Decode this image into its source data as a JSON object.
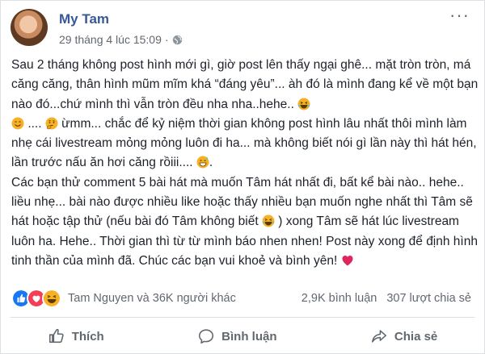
{
  "post": {
    "author": "My Tam",
    "timestamp": "29 tháng 4 lúc 15:09",
    "separator": "·",
    "privacy_icon": "globe-icon",
    "more_icon": "more-options-icon"
  },
  "content": {
    "p1_a": "Sau 2 tháng không post hình mới gì, giờ post lên thấy ngại ghê... mặt tròn tròn, má căng căng, thân hình mũm mĩm khá “đáng yêu”... àh đó là mình đang kể về một bạn nào đó...chứ mình thì vẫn tròn đều nha nha..hehe..",
    "p1_b": "....",
    "p1_c": "ừmm... chắc để kỷ niệm thời gian không post hình lâu nhất thôi mình làm nhẹ cái livestream mỏng mỏng luôn đi ha... mà không biết nói gì lần này thì hát hén, lần trước nấu ăn hơi căng rồiii....",
    "p1_d": ".",
    "p2_a": "Các bạn thử comment 5 bài hát mà muốn Tâm hát nhất đi, bất kể bài nào.. hehe.. liều nhẹ... bài nào được nhiều like hoặc thấy nhiều bạn muốn nghe nhất thì Tâm sẽ hát hoặc tập thử (nếu bài đó Tâm không biết",
    "p2_b": ") xong Tâm sẽ hát lúc livestream luôn ha. Hehe.. Thời gian thì từ từ mình báo nhen nhen! Post này xong để định hình tinh thần của mình đã. Chúc các bạn vui khoẻ và bình yên!"
  },
  "reactions": {
    "icons": [
      "like-reaction-icon",
      "love-reaction-icon",
      "haha-reaction-icon"
    ],
    "summary": "Tam Nguyen và 36K người khác",
    "comments": "2,9K bình luận",
    "shares": "307 lượt chia sẻ"
  },
  "actions": {
    "like": "Thích",
    "comment": "Bình luận",
    "share": "Chia sẻ"
  },
  "colors": {
    "author": "#385898",
    "meta": "#616770",
    "like_blue": "#1877f2",
    "love_red": "#f33e58",
    "haha_yellow": "#f7b125",
    "heart": "#e0245e"
  }
}
